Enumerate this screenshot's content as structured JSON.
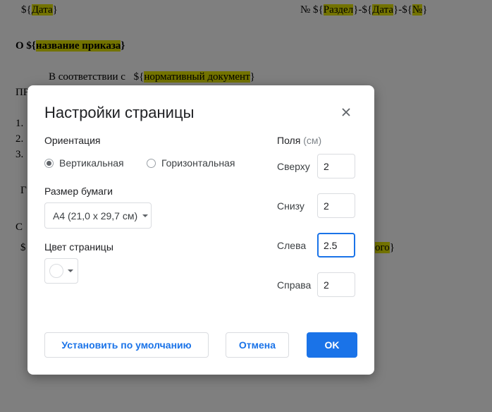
{
  "document": {
    "line1_left": {
      "prefix": "${",
      "hl": "Дата",
      "suffix": "}"
    },
    "line1_right": [
      "№ ${",
      "Раздел",
      "}-${",
      "Дата",
      "}-${",
      "№",
      "}"
    ],
    "title_line": {
      "prefix": "О ${",
      "hl": "название приказа",
      "suffix": "}"
    },
    "accordance": {
      "text": "В соответствии с",
      "prefix": "${",
      "hl": "нормативный документ",
      "suffix": "}"
    },
    "pr": "ПР",
    "list": [
      "1.",
      "2.",
      "3."
    ],
    "g": "Г",
    "s": "С",
    "dollar": "$",
    "partial_tail": {
      "hl": "ого",
      "suffix": "}"
    }
  },
  "dialog": {
    "title": "Настройки страницы",
    "close_glyph": "✕",
    "orientation": {
      "label": "Ориентация",
      "options": [
        {
          "label": "Вертикальная",
          "selected": true
        },
        {
          "label": "Горизонтальная",
          "selected": false
        }
      ]
    },
    "paper_size": {
      "label": "Размер бумаги",
      "value": "A4 (21,0 x 29,7 см)"
    },
    "page_color": {
      "label": "Цвет страницы",
      "value": "#ffffff"
    },
    "margins": {
      "label": "Поля",
      "unit": "(см)",
      "fields": [
        {
          "label": "Сверху",
          "value": "2"
        },
        {
          "label": "Снизу",
          "value": "2"
        },
        {
          "label": "Слева",
          "value": "2.5"
        },
        {
          "label": "Справа",
          "value": "2"
        }
      ]
    },
    "buttons": {
      "set_default": "Установить по умолчанию",
      "cancel": "Отмена",
      "ok": "OK"
    }
  },
  "colors": {
    "accent": "#1a73e8",
    "highlight": "#e6e600",
    "overlay": "rgba(0,0,0,0.5)"
  }
}
